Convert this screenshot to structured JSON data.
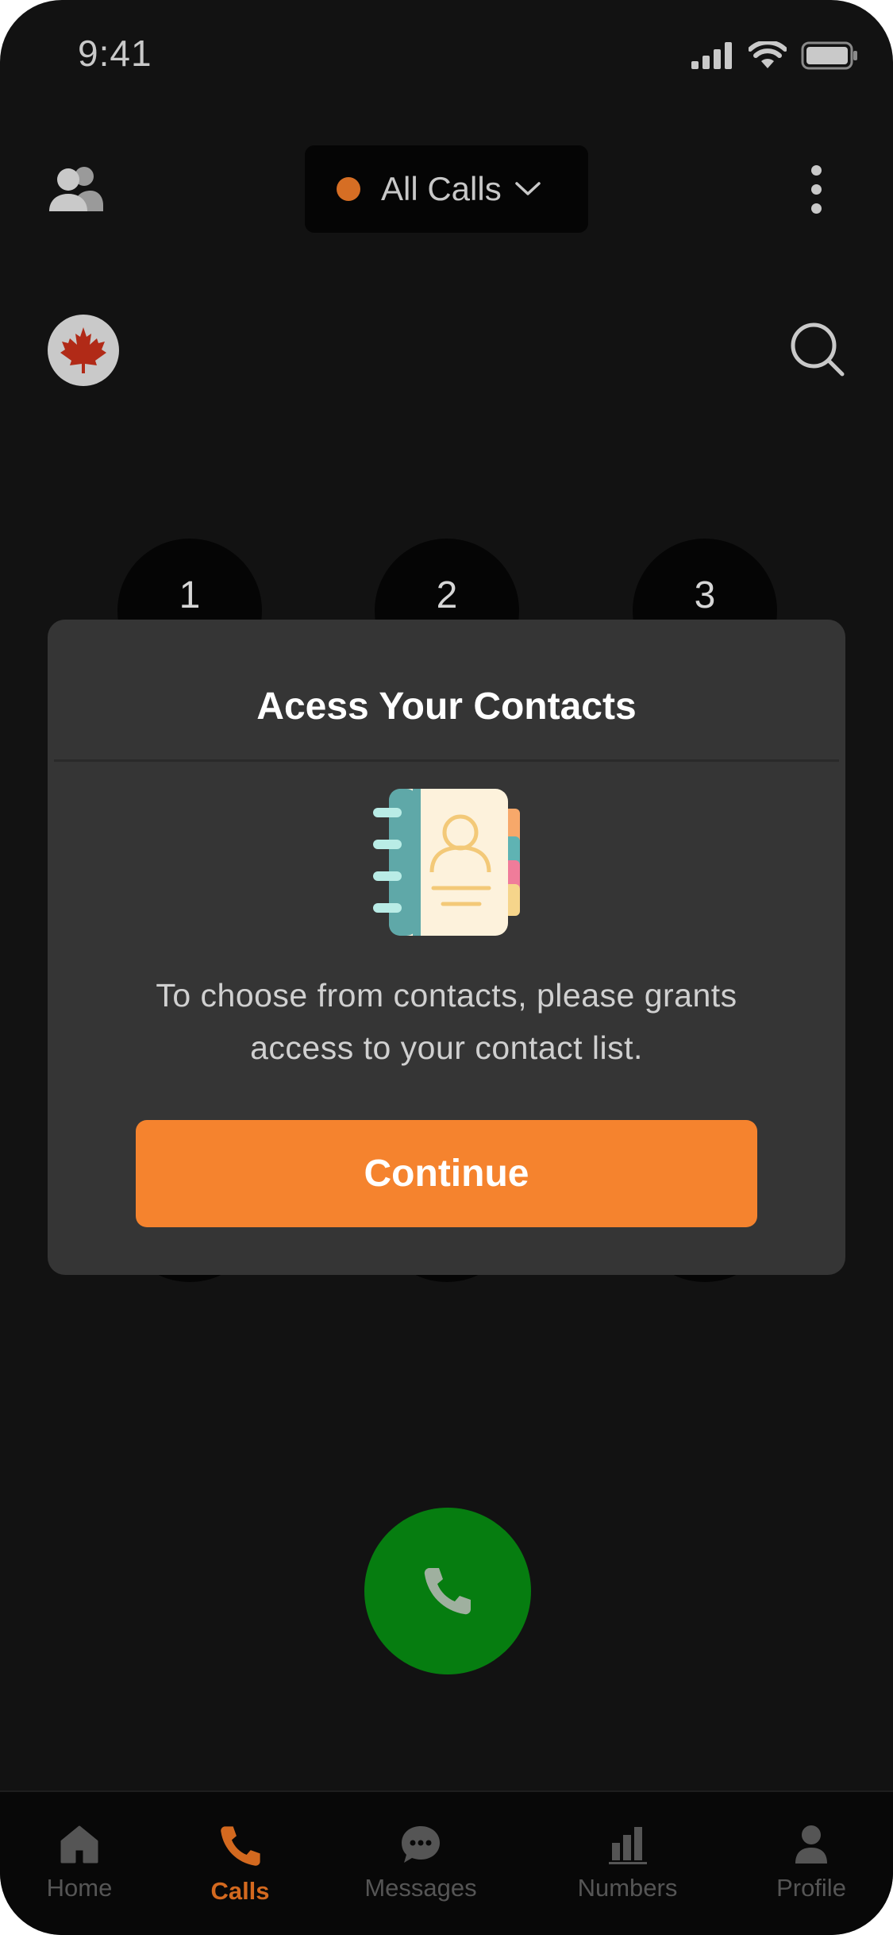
{
  "status_bar": {
    "time": "9:41"
  },
  "header": {
    "filter_label": "All Calls",
    "filter_dot_color": "#d66e24",
    "icons": [
      "people-icon",
      "chevron-down-icon",
      "more-vertical-icon"
    ]
  },
  "dial_row": {
    "country_flag": "canada-flag-icon",
    "search_icon": "search-icon"
  },
  "keypad": {
    "keys": [
      "1",
      "2",
      "3"
    ]
  },
  "dialog": {
    "title": "Acess Your Contacts",
    "illustration": "contact-book-icon",
    "message": "To choose from contacts, please grants access to your contact list.",
    "continue_label": "Continue",
    "accent_color": "#f5832e"
  },
  "call_button": {
    "icon": "phone-icon",
    "color": "#067d10"
  },
  "tab_bar": {
    "active_color": "#d3691f",
    "tabs": [
      {
        "label": "Home",
        "icon": "home-icon"
      },
      {
        "label": "Calls",
        "icon": "phone-icon",
        "active": true
      },
      {
        "label": "Messages",
        "icon": "chat-bubble-icon"
      },
      {
        "label": "Numbers",
        "icon": "bar-chart-icon"
      },
      {
        "label": "Profile",
        "icon": "user-icon"
      }
    ]
  }
}
